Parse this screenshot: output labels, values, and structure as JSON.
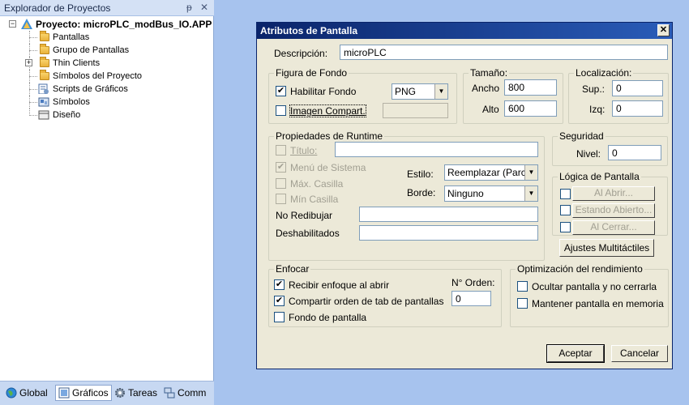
{
  "explorer": {
    "title": "Explorador de Proyectos",
    "pin_glyph": "ᵽ",
    "close_glyph": "✕",
    "root": "Proyecto: microPLC_modBus_IO.APP",
    "items": [
      {
        "label": "Pantallas",
        "icon": "folder-icon"
      },
      {
        "label": "Grupo de Pantallas",
        "icon": "folder-icon"
      },
      {
        "label": "Thin Clients",
        "icon": "folder-icon"
      },
      {
        "label": "Símbolos del Proyecto",
        "icon": "folder-icon"
      },
      {
        "label": "Scripts de Gráficos",
        "icon": "script-icon"
      },
      {
        "label": "Símbolos",
        "icon": "symbols-icon"
      },
      {
        "label": "Diseño",
        "icon": "layout-icon"
      }
    ],
    "tabs": [
      {
        "label": "Global",
        "icon": "globe-icon"
      },
      {
        "label": "Gráficos",
        "icon": "graphics-icon"
      },
      {
        "label": "Tareas",
        "icon": "gear-icon"
      },
      {
        "label": "Comm",
        "icon": "network-icon"
      }
    ]
  },
  "dialog": {
    "title": "Atributos de Pantalla",
    "close_glyph": "✕",
    "descripcion": {
      "label": "Descripción:",
      "value": "microPLC"
    },
    "figura_fondo": {
      "title": "Figura de Fondo",
      "habilitar_fondo": {
        "label": "Habilitar Fondo",
        "checked": true
      },
      "format": "PNG",
      "imagen_compart": {
        "label": "Imagen Compart.",
        "checked": false
      },
      "imagen_value": ""
    },
    "tamano": {
      "title": "Tamaño:",
      "ancho_label": "Ancho",
      "ancho": "800",
      "alto_label": "Alto",
      "alto": "600"
    },
    "localizacion": {
      "title": "Localización:",
      "sup_label": "Sup.:",
      "sup": "0",
      "izq_label": "Izq:",
      "izq": "0"
    },
    "runtime": {
      "title": "Propiedades de Runtime",
      "titulo_label": "Título:",
      "titulo_value": "",
      "menu_sistema": "Menú de Sistema",
      "max_casilla": "Máx. Casilla",
      "min_casilla": "Mín Casilla",
      "estilo_label": "Estilo:",
      "estilo_value": "Reemplazar (Parcia",
      "borde_label": "Borde:",
      "borde_value": "Ninguno",
      "no_redibujar": "No Redibujar",
      "no_redibujar_value": "",
      "deshabilitados": "Deshabilitados",
      "deshabilitados_value": ""
    },
    "seguridad": {
      "title": "Seguridad",
      "nivel_label": "Nivel:",
      "nivel": "0"
    },
    "logica": {
      "title": "Lógica de Pantalla",
      "al_abrir": "Al Abrir...",
      "estando_abierto": "Estando Abierto...",
      "al_cerrar": "Al Cerrar..."
    },
    "ajustes_label": "Ajustes Multitáctiles",
    "enfocar": {
      "title": "Enfocar",
      "recibir": {
        "label": "Recibir enfoque al abrir",
        "checked": true
      },
      "compartir": {
        "label": "Compartir orden de tab de pantallas",
        "checked": true
      },
      "fondo": {
        "label": "Fondo de pantalla",
        "checked": false
      },
      "orden_label": "N° Orden:",
      "orden": "0"
    },
    "optimizacion": {
      "title": "Optimización del rendimiento",
      "ocultar": {
        "label": "Ocultar pantalla y no cerrarla",
        "checked": false
      },
      "mantener": {
        "label": "Mantener pantalla en memoria",
        "checked": false
      }
    },
    "aceptar_label": "Aceptar",
    "cancelar_label": "Cancelar"
  },
  "glyphs": {
    "check": "✔",
    "dropdown": "▼",
    "minus": "−",
    "plus": "+"
  }
}
